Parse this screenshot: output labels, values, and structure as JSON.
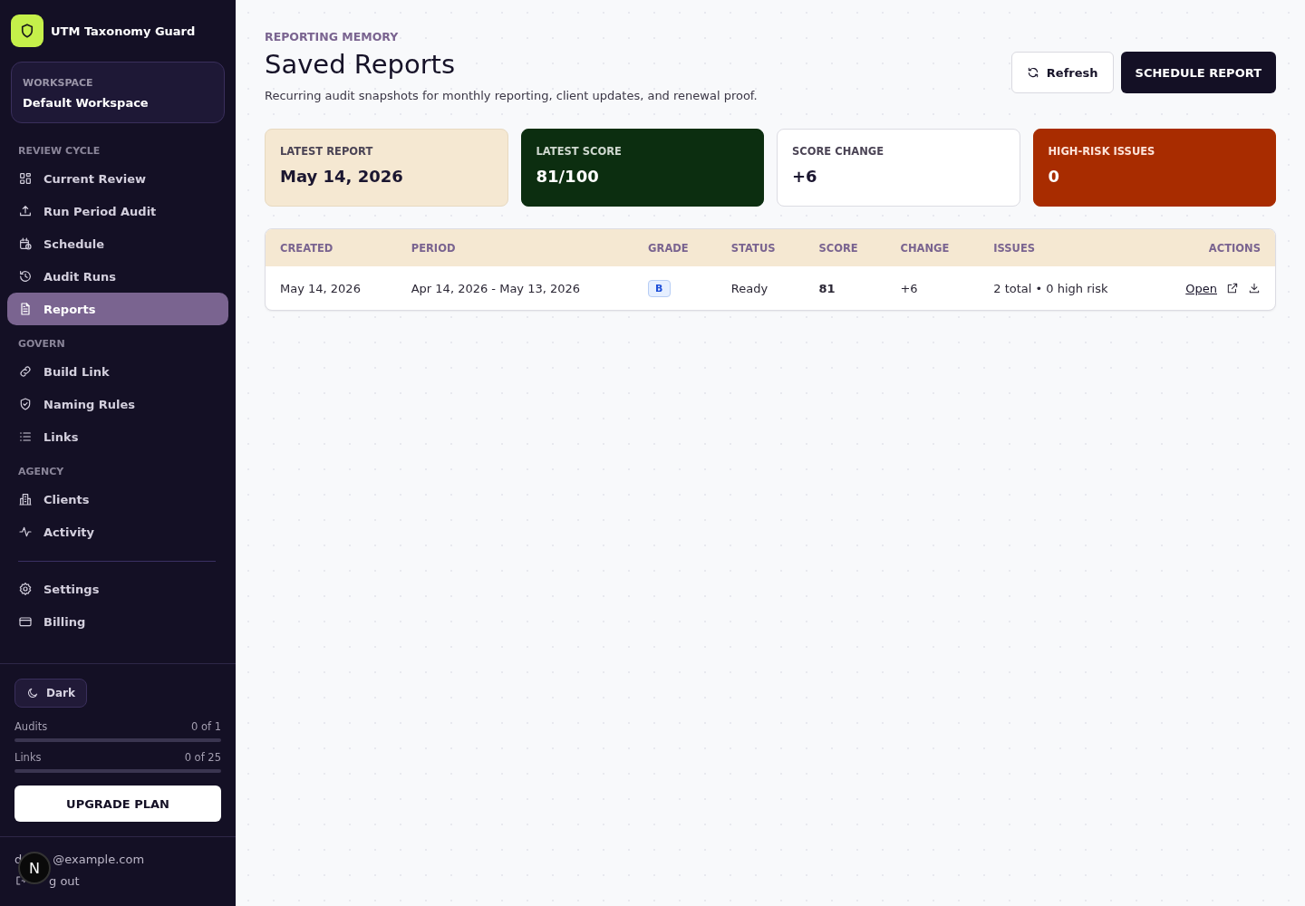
{
  "app": {
    "name": "UTM Taxonomy Guard"
  },
  "workspace": {
    "label": "WORKSPACE",
    "name": "Default Workspace"
  },
  "nav": [
    {
      "heading": "REVIEW CYCLE",
      "items": [
        {
          "label": "Current Review",
          "selected": false
        },
        {
          "label": "Run Period Audit",
          "selected": false
        },
        {
          "label": "Schedule",
          "selected": false
        },
        {
          "label": "Audit Runs",
          "selected": false
        },
        {
          "label": "Reports",
          "selected": true
        }
      ]
    },
    {
      "heading": "GOVERN",
      "items": [
        {
          "label": "Build Link",
          "selected": false
        },
        {
          "label": "Naming Rules",
          "selected": false
        },
        {
          "label": "Links",
          "selected": false
        }
      ]
    },
    {
      "heading": "AGENCY",
      "items": [
        {
          "label": "Clients",
          "selected": false
        },
        {
          "label": "Activity",
          "selected": false
        }
      ]
    },
    {
      "items": [
        {
          "label": "Settings",
          "selected": false
        },
        {
          "label": "Billing",
          "selected": false
        }
      ]
    }
  ],
  "theme_button": "Dark",
  "usage": [
    {
      "label": "Audits",
      "reading": "0 of 1",
      "level": 0
    },
    {
      "label": "Links",
      "reading": "0 of 25",
      "level": 0
    }
  ],
  "upgrade_button": "UPGRADE PLAN",
  "account": {
    "email_parts": [
      "d",
      "@example.com"
    ],
    "logout_parts": [
      "g out"
    ],
    "badge": "N"
  },
  "page": {
    "eyebrow": "REPORTING MEMORY",
    "title": "Saved Reports",
    "subtitle": "Recurring audit snapshots for monthly reporting, client updates, and renewal proof.",
    "refresh_button": "Refresh",
    "schedule_button": "SCHEDULE REPORT"
  },
  "stats": [
    {
      "label": "LATEST REPORT",
      "value": "May 14, 2026",
      "kind": "cream"
    },
    {
      "label": "LATEST SCORE",
      "value": "81/100",
      "kind": "green"
    },
    {
      "label": "SCORE CHANGE",
      "value": "+6",
      "kind": "plain"
    },
    {
      "label": "HIGH-RISK ISSUES",
      "value": "0",
      "kind": "red"
    }
  ],
  "table": {
    "columns": [
      "CREATED",
      "PERIOD",
      "GRADE",
      "STATUS",
      "SCORE",
      "CHANGE",
      "ISSUES",
      "ACTIONS"
    ],
    "rows": [
      {
        "created": "May 14, 2026",
        "period": "Apr 14, 2026 - May 13, 2026",
        "grade": "B",
        "status": "Ready",
        "score": "81",
        "change": "+6",
        "issues": "2 total • 0 high risk",
        "open_link": "Open"
      }
    ]
  }
}
